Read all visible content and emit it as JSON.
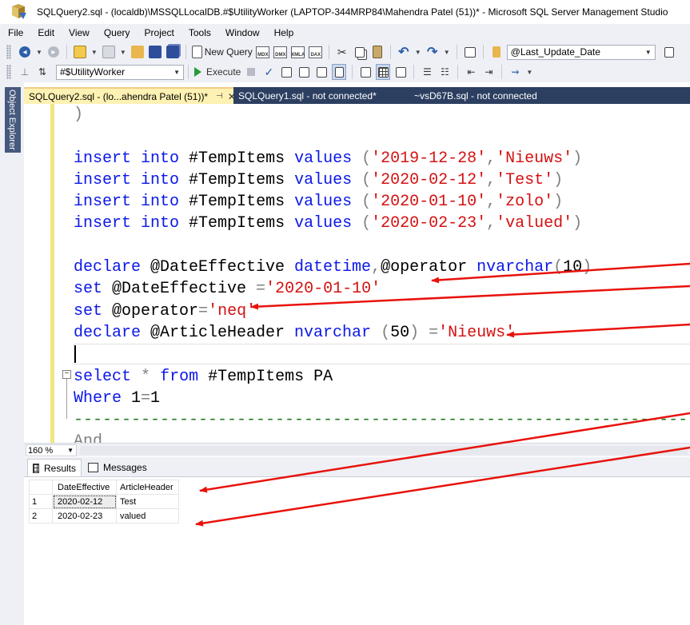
{
  "window": {
    "title": "SQLQuery2.sql - (localdb)\\MSSQLLocalDB.#$UtilityWorker (LAPTOP-344MRP84\\Mahendra Patel (51))* - Microsoft SQL Server Management Studio"
  },
  "menu": {
    "items": [
      "File",
      "Edit",
      "View",
      "Query",
      "Project",
      "Tools",
      "Window",
      "Help"
    ]
  },
  "toolbar1": {
    "new_query_label": "New Query",
    "mini_icons": [
      "MDX",
      "DMX",
      "XMLA",
      "DAX"
    ],
    "search_combo_value": "@Last_Update_Date"
  },
  "toolbar2": {
    "database_combo_value": "#$UtilityWorker",
    "execute_label": "Execute"
  },
  "left_panel": {
    "object_explorer_label": "Object Explorer"
  },
  "document_tabs": [
    {
      "label": "SQLQuery2.sql - (lo...ahendra Patel (51))*",
      "active": true
    },
    {
      "label": "SQLQuery1.sql - not connected*",
      "active": false
    },
    {
      "label": "~vsD67B.sql - not connected",
      "active": false
    }
  ],
  "editor": {
    "lines": [
      [
        {
          "t": ")",
          "c": "gray"
        }
      ],
      [],
      [
        {
          "t": "insert",
          "c": "kw"
        },
        {
          "t": " ",
          "c": "plain"
        },
        {
          "t": "into",
          "c": "kw"
        },
        {
          "t": " #TempItems ",
          "c": "plain"
        },
        {
          "t": "values",
          "c": "kw"
        },
        {
          "t": " (",
          "c": "gray"
        },
        {
          "t": "'2019-12-28'",
          "c": "str"
        },
        {
          "t": ",",
          "c": "gray"
        },
        {
          "t": "'Nieuws'",
          "c": "str"
        },
        {
          "t": ")",
          "c": "gray"
        }
      ],
      [
        {
          "t": "insert",
          "c": "kw"
        },
        {
          "t": " ",
          "c": "plain"
        },
        {
          "t": "into",
          "c": "kw"
        },
        {
          "t": " #TempItems ",
          "c": "plain"
        },
        {
          "t": "values",
          "c": "kw"
        },
        {
          "t": " (",
          "c": "gray"
        },
        {
          "t": "'2020-02-12'",
          "c": "str"
        },
        {
          "t": ",",
          "c": "gray"
        },
        {
          "t": "'Test'",
          "c": "str"
        },
        {
          "t": ")",
          "c": "gray"
        }
      ],
      [
        {
          "t": "insert",
          "c": "kw"
        },
        {
          "t": " ",
          "c": "plain"
        },
        {
          "t": "into",
          "c": "kw"
        },
        {
          "t": " #TempItems ",
          "c": "plain"
        },
        {
          "t": "values",
          "c": "kw"
        },
        {
          "t": " (",
          "c": "gray"
        },
        {
          "t": "'2020-01-10'",
          "c": "str"
        },
        {
          "t": ",",
          "c": "gray"
        },
        {
          "t": "'zolo'",
          "c": "str"
        },
        {
          "t": ")",
          "c": "gray"
        }
      ],
      [
        {
          "t": "insert",
          "c": "kw"
        },
        {
          "t": " ",
          "c": "plain"
        },
        {
          "t": "into",
          "c": "kw"
        },
        {
          "t": " #TempItems ",
          "c": "plain"
        },
        {
          "t": "values",
          "c": "kw"
        },
        {
          "t": " (",
          "c": "gray"
        },
        {
          "t": "'2020-02-23'",
          "c": "str"
        },
        {
          "t": ",",
          "c": "gray"
        },
        {
          "t": "'valued'",
          "c": "str"
        },
        {
          "t": ")",
          "c": "gray"
        }
      ],
      [],
      [
        {
          "t": "declare",
          "c": "kw"
        },
        {
          "t": " @DateEffective ",
          "c": "plain"
        },
        {
          "t": "datetime",
          "c": "kw"
        },
        {
          "t": ",",
          "c": "gray"
        },
        {
          "t": "@operator ",
          "c": "plain"
        },
        {
          "t": "nvarchar",
          "c": "kw"
        },
        {
          "t": "(",
          "c": "gray"
        },
        {
          "t": "10",
          "c": "plain"
        },
        {
          "t": ")",
          "c": "gray"
        }
      ],
      [
        {
          "t": "set",
          "c": "kw"
        },
        {
          "t": " @DateEffective ",
          "c": "plain"
        },
        {
          "t": "=",
          "c": "gray"
        },
        {
          "t": "'2020-01-10'",
          "c": "str"
        }
      ],
      [
        {
          "t": "set",
          "c": "kw"
        },
        {
          "t": " @operator",
          "c": "plain"
        },
        {
          "t": "=",
          "c": "gray"
        },
        {
          "t": "'neq'",
          "c": "str"
        }
      ],
      [
        {
          "t": "declare",
          "c": "kw"
        },
        {
          "t": " @ArticleHeader ",
          "c": "plain"
        },
        {
          "t": "nvarchar",
          "c": "kw"
        },
        {
          "t": " (",
          "c": "gray"
        },
        {
          "t": "50",
          "c": "plain"
        },
        {
          "t": ") ",
          "c": "gray"
        },
        {
          "t": "=",
          "c": "gray"
        },
        {
          "t": "'Nieuws'",
          "c": "str"
        }
      ],
      [],
      [
        {
          "t": "select",
          "c": "kw"
        },
        {
          "t": " ",
          "c": "plain"
        },
        {
          "t": "*",
          "c": "gray"
        },
        {
          "t": " ",
          "c": "plain"
        },
        {
          "t": "from",
          "c": "kw"
        },
        {
          "t": " #TempItems PA",
          "c": "plain"
        }
      ],
      [
        {
          "t": "Where",
          "c": "kw"
        },
        {
          "t": " 1",
          "c": "plain"
        },
        {
          "t": "=",
          "c": "gray"
        },
        {
          "t": "1",
          "c": "plain"
        }
      ],
      [
        {
          "t": "------------------------------------------------------------------",
          "c": "cmt"
        }
      ],
      [
        {
          "t": "And",
          "c": "gray"
        }
      ]
    ]
  },
  "zoom": {
    "value": "160 %"
  },
  "results_tabs": {
    "results_label": "Results",
    "messages_label": "Messages"
  },
  "results": {
    "columns": [
      "DateEffective",
      "ArticleHeader"
    ],
    "rows": [
      {
        "num": "1",
        "cells": [
          "2020-02-12",
          "Test"
        ]
      },
      {
        "num": "2",
        "cells": [
          "2020-02-23",
          "valued"
        ]
      }
    ]
  },
  "colors": {
    "keyword": "#0b18e6",
    "string": "#d41111",
    "comment": "#1f7a1f",
    "annotation_arrow": "#e8120c",
    "tab_strip": "#2c3f61",
    "active_tab": "#fdf2b3"
  }
}
